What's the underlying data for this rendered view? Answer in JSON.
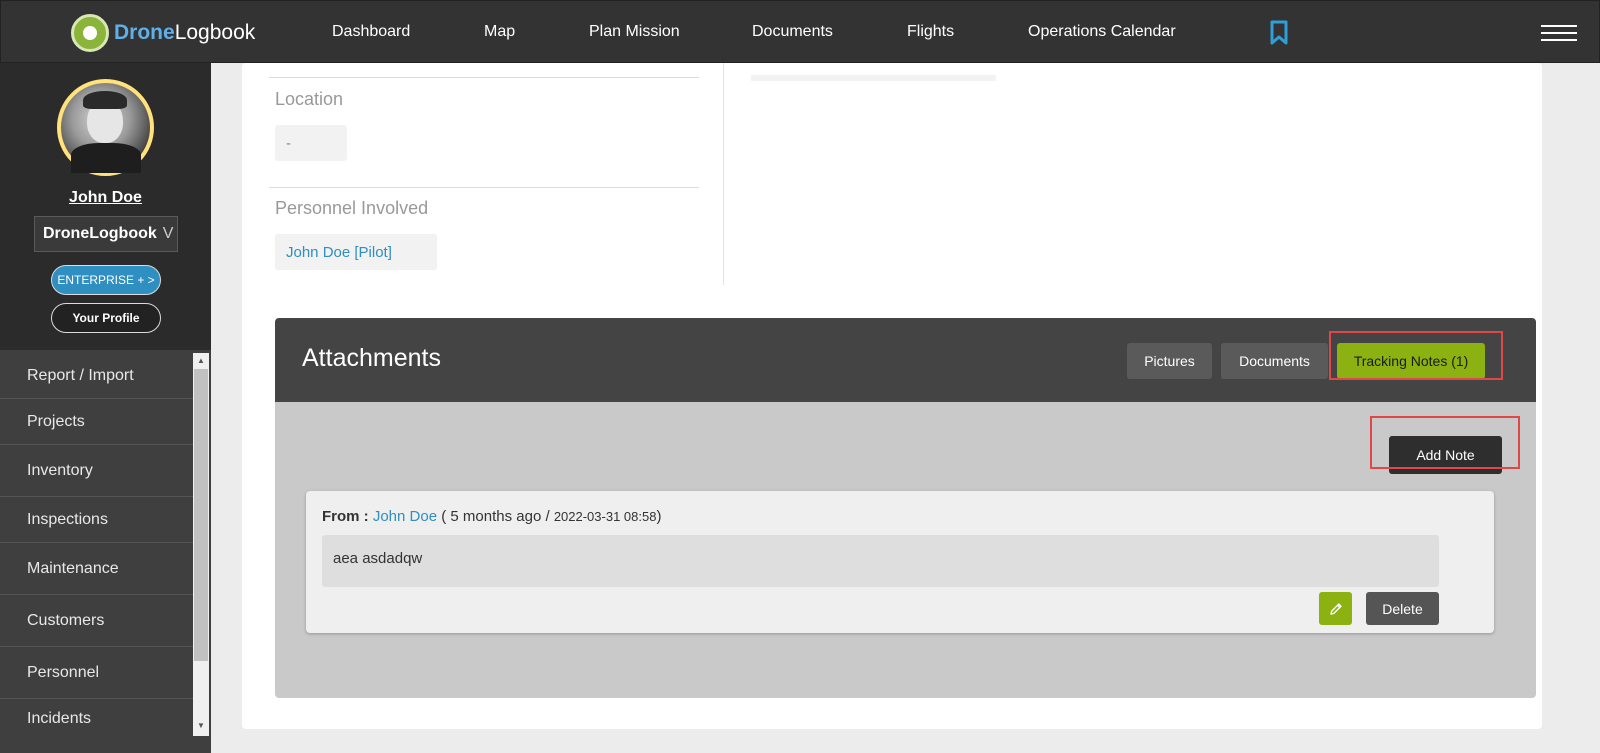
{
  "brand": {
    "part1": "Drone",
    "part2": "Logbook"
  },
  "nav": {
    "items": [
      "Dashboard",
      "Map",
      "Plan Mission",
      "Documents",
      "Flights",
      "Operations Calendar"
    ],
    "bookmark_icon": "bookmark-icon",
    "menu_icon": "hamburger-menu-icon"
  },
  "sidebar": {
    "user_name": "John Doe",
    "org": "DroneLogbook",
    "org_chevron": "V",
    "enterprise_label": "ENTERPRISE + >",
    "profile_label": "Your Profile",
    "menu": [
      "Report / Import",
      "Projects",
      "Inventory",
      "Inspections",
      "Maintenance",
      "Customers",
      "Personnel",
      "Incidents"
    ]
  },
  "details": {
    "location_label": "Location",
    "location_value": "-",
    "personnel_label": "Personnel Involved",
    "personnel_value": "John Doe [Pilot]"
  },
  "attachments": {
    "title": "Attachments",
    "tabs": [
      "Pictures",
      "Documents",
      "Tracking Notes (1)"
    ],
    "active_tab": "Tracking Notes (1)",
    "add_note_label": "Add Note",
    "note": {
      "from_label": "From :",
      "author": "John Doe",
      "relative_time": "( 5 months ago /",
      "timestamp": "2022-03-31 08:58",
      "close_paren": ")",
      "text": "aea asdadqw",
      "delete_label": "Delete"
    }
  },
  "colors": {
    "accent_green": "#8cb211",
    "link_blue": "#2e8fc0",
    "highlight_red": "#e04848"
  }
}
